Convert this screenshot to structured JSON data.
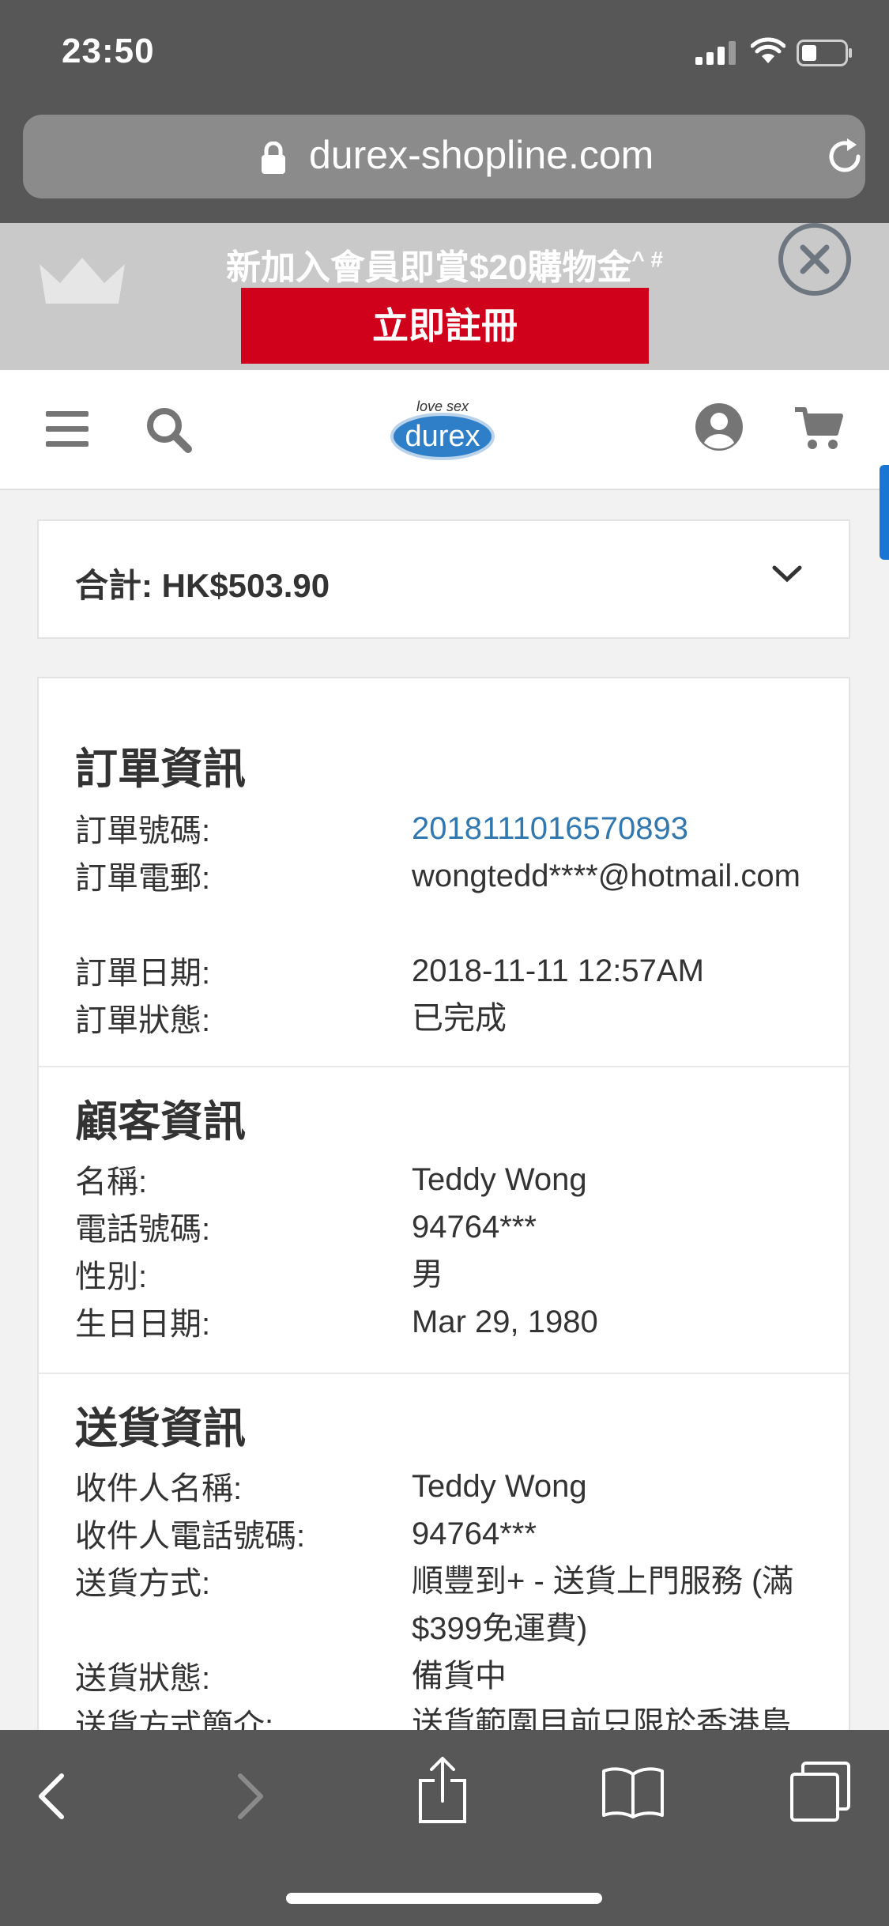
{
  "status_bar": {
    "time": "23:50"
  },
  "browser": {
    "url": "durex-shopline.com"
  },
  "promo": {
    "text": "新加入會員即賞$20購物金",
    "superscript": "^ #",
    "register_label": "立即註冊"
  },
  "header": {
    "logo_top": "love sex",
    "logo_brand": "durex"
  },
  "total": {
    "label": "合計: HK$503.90"
  },
  "order_info": {
    "title": "訂單資訊",
    "rows": [
      {
        "label": "訂單號碼:",
        "value": "2018111016570893"
      },
      {
        "label": "訂單電郵:",
        "value": "wongtedd****@hotmail.com"
      },
      {
        "label": "訂單日期:",
        "value": "2018-11-11 12:57AM"
      },
      {
        "label": "訂單狀態:",
        "value": "已完成"
      }
    ]
  },
  "customer_info": {
    "title": "顧客資訊",
    "rows": [
      {
        "label": "名稱:",
        "value": "Teddy Wong"
      },
      {
        "label": "電話號碼:",
        "value": "94764***"
      },
      {
        "label": "性別:",
        "value": "男"
      },
      {
        "label": "生日日期:",
        "value": "Mar 29, 1980"
      }
    ]
  },
  "delivery_info": {
    "title": "送貨資訊",
    "rows": [
      {
        "label": "收件人名稱:",
        "value": "Teddy Wong"
      },
      {
        "label": "收件人電話號碼:",
        "value": "94764***"
      },
      {
        "label": "送貨方式:",
        "value": "順豐到+ - 送貨上門服務 (滿$399免運費)"
      },
      {
        "label": "送貨狀態:",
        "value": "備貨中"
      },
      {
        "label": "送貨方式簡介:",
        "value": "送貨範圍目前只限於香港島"
      }
    ]
  },
  "colors": {
    "accent_red": "#d0021b",
    "link_blue": "#3278b0",
    "chrome_gray": "#575757"
  }
}
